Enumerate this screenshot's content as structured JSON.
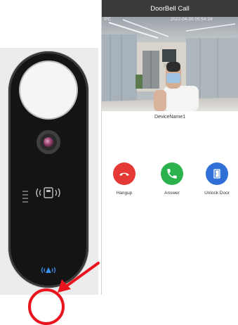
{
  "phone": {
    "title": "DoorBell Call",
    "video": {
      "overlay_label": "IPC",
      "timestamp": "2022-04-20 05:54:24"
    },
    "device_name": "DeviceName1",
    "actions": [
      {
        "label": "Hangup",
        "color": "#e53935"
      },
      {
        "label": "Answer",
        "color": "#2bb24c"
      },
      {
        "label": "Unlock Door",
        "color": "#2f6fd6"
      }
    ]
  },
  "colors": {
    "header_bg": "#3a3a3a",
    "highlight": "#e8141e",
    "led": "#3a8fe8"
  },
  "device": {
    "icons": [
      "speaker-grille-icon",
      "nfc-card-icon",
      "status-led-icon"
    ]
  }
}
